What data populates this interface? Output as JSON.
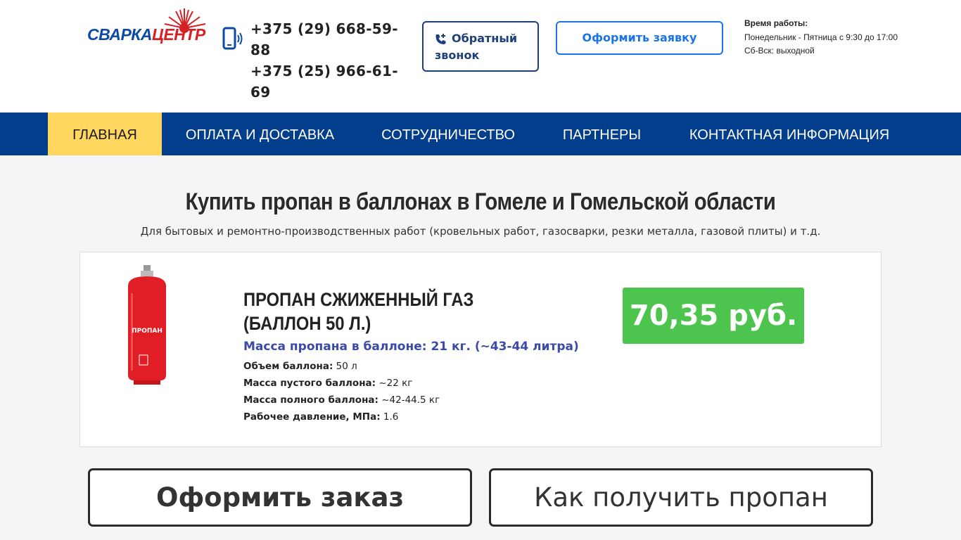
{
  "header": {
    "logo_part1": "СВАРКА",
    "logo_part2": "ЦЕНТР",
    "phones": [
      "+375 (29) 668-59-88",
      "+375 (25) 966-61-69"
    ],
    "callback_label": "Обратный звонок",
    "order_label": "Оформить заявку",
    "hours_title": "Время работы:",
    "hours_weekdays": "Понедельник - Пятница с 9:30 до 17:00",
    "hours_weekend": "Сб-Вск: выходной"
  },
  "nav": {
    "items": [
      {
        "label": "ГЛАВНАЯ",
        "active": true
      },
      {
        "label": "ОПЛАТА И ДОСТАВКА",
        "active": false
      },
      {
        "label": "СОТРУДНИЧЕСТВО",
        "active": false
      },
      {
        "label": "ПАРТНЕРЫ",
        "active": false
      },
      {
        "label": "КОНТАКТНАЯ ИНФОРМАЦИЯ",
        "active": false
      }
    ]
  },
  "main": {
    "title": "Купить пропан в баллонах в Гомеле и Гомельской области",
    "subtitle": "Для бытовых и ремонтно-производственных работ (кровельных работ, газосварки, резки металла, газовой плиты) и т.д."
  },
  "product": {
    "name": "ПРОПАН СЖИЖЕННЫЙ ГАЗ (БАЛЛОН 50 Л.)",
    "mass_line": "Масса пропана в баллоне: 21 кг. (~43-44 литра)",
    "specs": [
      {
        "key": "Объем баллона:",
        "value": "50 л"
      },
      {
        "key": "Масса пустого баллона:",
        "value": "~22 кг"
      },
      {
        "key": "Масса полного баллона:",
        "value": "~42-44.5 кг"
      },
      {
        "key": "Рабочее давление, МПа:",
        "value": "1.6"
      }
    ],
    "price": "70,35 руб.",
    "cylinder_label": "ПРОПАН"
  },
  "actions": {
    "order_label": "Оформить заказ",
    "how_label": "Как получить пропан"
  },
  "colors": {
    "nav_bg": "#033e8c",
    "nav_active": "#ffd75e",
    "price_bg": "#4dc44d",
    "accent_blue": "#1a73e8",
    "logo_blue": "#0b4aa6",
    "logo_red": "#d81f26"
  },
  "icons": {
    "phone": "smartphone-icon",
    "callback": "phone-callback-icon",
    "logo_sun": "sunburst-icon"
  }
}
